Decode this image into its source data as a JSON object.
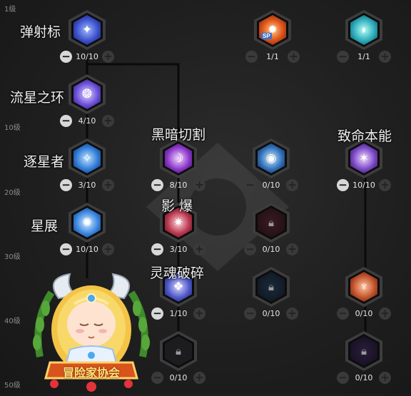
{
  "levels": [
    "1级",
    "10级",
    "20级",
    "30级",
    "40级",
    "50级"
  ],
  "skills": [
    {
      "name": "弹射标",
      "count": "10/10",
      "icon": "dart-star-icon"
    },
    {
      "name": "",
      "count": "1/1",
      "icon": "sp-fire-icon",
      "badge": "SP"
    },
    {
      "name": "",
      "count": "1/1",
      "icon": "cyan-shield-icon"
    },
    {
      "name": "流星之环",
      "count": "4/10",
      "icon": "meteor-ring-icon"
    },
    {
      "name": "逐星者",
      "count": "3/10",
      "icon": "star-chaser-icon"
    },
    {
      "name": "黑暗切割",
      "count": "8/10",
      "icon": "dark-cut-icon"
    },
    {
      "name": "",
      "count": "0/10",
      "icon": "blue-vortex-icon"
    },
    {
      "name": "致命本能",
      "count": "10/10",
      "icon": "fatal-instinct-icon"
    },
    {
      "name": "星展",
      "count": "10/10",
      "icon": "star-burst-icon"
    },
    {
      "name": "影 爆",
      "count": "3/10",
      "icon": "shadow-burst-icon"
    },
    {
      "name": "",
      "count": "0/10",
      "icon": "lock-icon"
    },
    {
      "name": "灵魂破碎",
      "count": "1/10",
      "icon": "soul-shatter-icon"
    },
    {
      "name": "",
      "count": "0/10",
      "icon": "lock-icon"
    },
    {
      "name": "",
      "count": "0/10",
      "icon": "orange-figure-icon"
    },
    {
      "name": "",
      "count": "0/10",
      "icon": "lock-icon"
    },
    {
      "name": "",
      "count": "0/10",
      "icon": "lock-icon"
    }
  ],
  "logo_text": "冒险家协会",
  "colors": {
    "background": "#1f1f1f",
    "connector": "#0a0a0a",
    "logo_banner": "#d8541c",
    "wreath": "#3f8a2c"
  }
}
